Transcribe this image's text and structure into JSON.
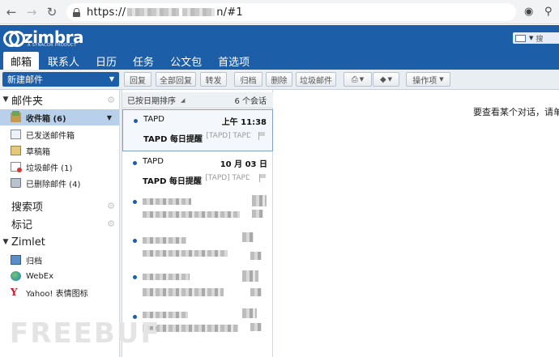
{
  "browser": {
    "url_prefix": "https://",
    "url_suffix": "n/#1",
    "icons": [
      "back-icon",
      "forward-icon",
      "reload-icon",
      "lock-icon",
      "eye-icon",
      "key-icon"
    ]
  },
  "header": {
    "logo_text": "zimbra",
    "logo_sub": "A SYNACOR PRODUCT"
  },
  "tabs": [
    "邮箱",
    "联系人",
    "日历",
    "任务",
    "公文包",
    "首选项"
  ],
  "toolbar": {
    "new_mail": "新建邮件",
    "reply": "回复",
    "reply_all": "全部回复",
    "forward": "转发",
    "archive": "归档",
    "delete": "删除",
    "spam": "垃圾邮件",
    "actions": "操作项"
  },
  "sidebar": {
    "mail_folders_title": "邮件夹",
    "folders": [
      {
        "label": "收件箱 (6)"
      },
      {
        "label": "已发送邮件箱"
      },
      {
        "label": "草稿箱"
      },
      {
        "label": "垃圾邮件 (1)"
      },
      {
        "label": "已删除邮件 (4)"
      }
    ],
    "searches_title": "搜索项",
    "tags_title": "标记",
    "zimlet_title": "Zimlet",
    "zimlets": [
      {
        "label": "归档"
      },
      {
        "label": "WebEx"
      },
      {
        "label": "Yahoo! 表情图标"
      }
    ]
  },
  "message_list": {
    "sort_label": "已按日期排序",
    "count": "6 个会话",
    "messages": [
      {
        "from": "TAPD",
        "date": "上午 11:38",
        "subject": "TAPD 每日提醒",
        "fragment": "– [TAPD] TAPD"
      },
      {
        "from": "TAPD",
        "date": "10 月 03 日",
        "subject": "TAPD 每日提醒",
        "fragment": "– [TAPD] TAPD"
      }
    ]
  },
  "reading_pane": {
    "hint": "要查看某个对话，请单"
  },
  "colors": {
    "brand_blue": "#1d5ea8",
    "selection": "#b9d0ea"
  }
}
